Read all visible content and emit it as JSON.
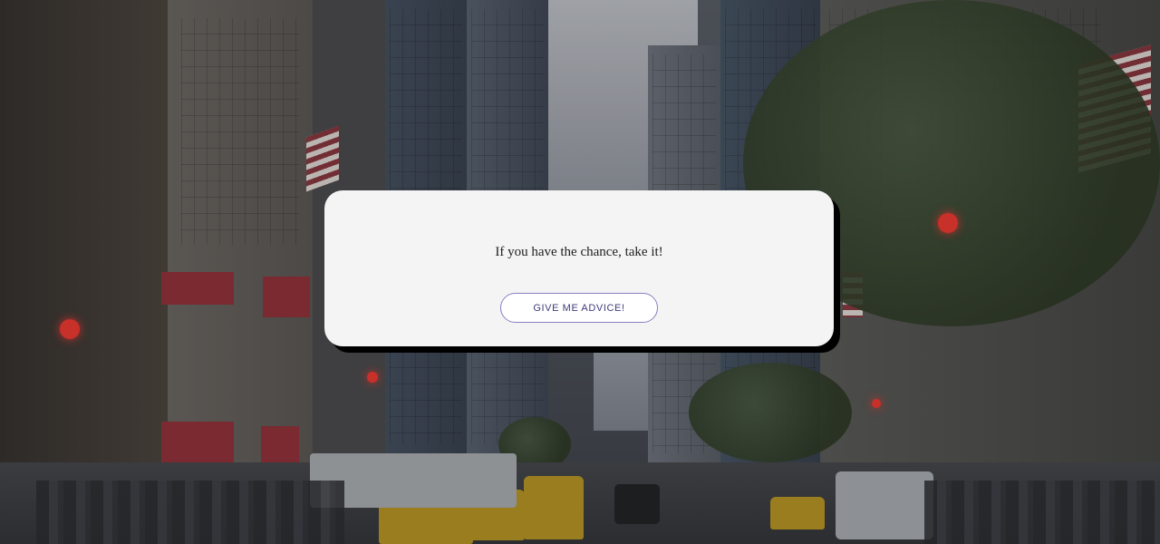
{
  "advice": {
    "text": "If you have the chance, take it!"
  },
  "button": {
    "label": "GIVE ME ADVICE!"
  },
  "background": {
    "image": "city-street-photo",
    "overlay_color": "#000000"
  },
  "colors": {
    "card_background": "#f4f4f4",
    "card_shadow": "#000000",
    "button_border": "#8a7fc1",
    "button_text": "#403a7a"
  }
}
